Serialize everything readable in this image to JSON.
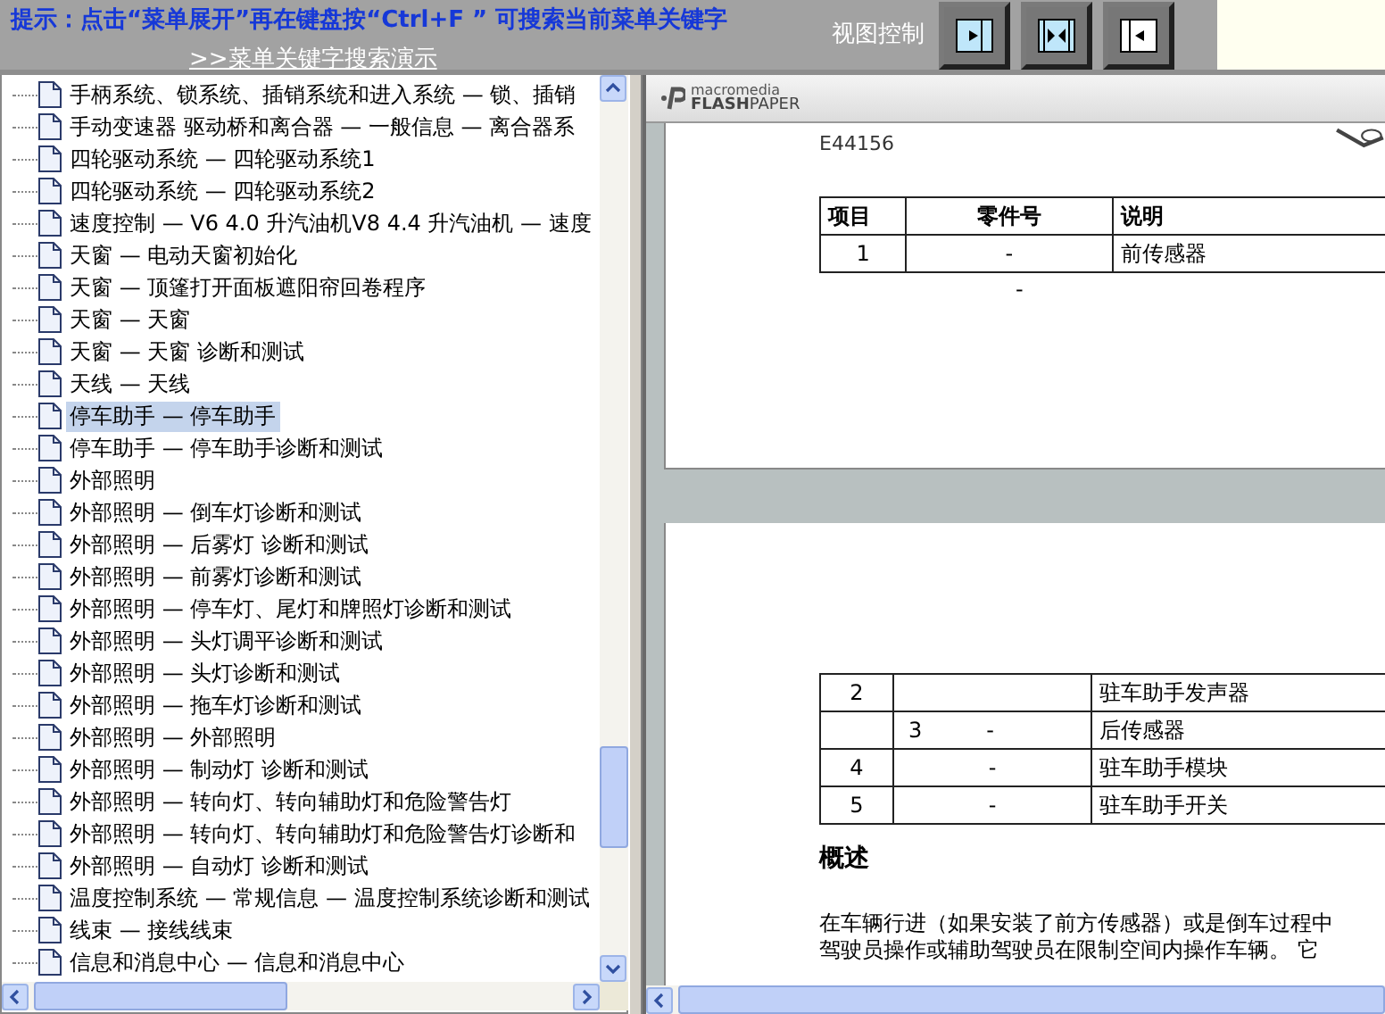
{
  "header": {
    "hint": "提示：点击“菜单展开”再在键盘按“Ctrl+F ” 可搜索当前菜单关键字",
    "demo_link": ">>菜单关键字搜索演示",
    "view_control_label": "视图控制",
    "view_buttons": [
      {
        "kind": "expand-right",
        "selected": false
      },
      {
        "kind": "split",
        "selected": false
      },
      {
        "kind": "expand-left",
        "selected": false
      }
    ]
  },
  "tree": {
    "items": [
      {
        "label": "手柄系统、锁系统、插销系统和进入系统 — 锁、插销",
        "selected": false
      },
      {
        "label": "手动变速器 驱动桥和离合器 — 一般信息 — 离合器系",
        "selected": false
      },
      {
        "label": "四轮驱动系统 — 四轮驱动系统1",
        "selected": false
      },
      {
        "label": "四轮驱动系统 — 四轮驱动系统2",
        "selected": false
      },
      {
        "label": "速度控制 — V6 4.0 升汽油机V8 4.4 升汽油机 — 速度",
        "selected": false
      },
      {
        "label": "天窗 — 电动天窗初始化",
        "selected": false
      },
      {
        "label": "天窗 — 顶篷打开面板遮阳帘回卷程序",
        "selected": false
      },
      {
        "label": "天窗 — 天窗",
        "selected": false
      },
      {
        "label": "天窗 — 天窗 诊断和测试",
        "selected": false
      },
      {
        "label": "天线 — 天线",
        "selected": false
      },
      {
        "label": "停车助手 — 停车助手",
        "selected": true
      },
      {
        "label": "停车助手 — 停车助手诊断和测试",
        "selected": false
      },
      {
        "label": "外部照明",
        "selected": false
      },
      {
        "label": "外部照明 — 倒车灯诊断和测试",
        "selected": false
      },
      {
        "label": "外部照明 — 后雾灯 诊断和测试",
        "selected": false
      },
      {
        "label": "外部照明 — 前雾灯诊断和测试",
        "selected": false
      },
      {
        "label": "外部照明 — 停车灯、尾灯和牌照灯诊断和测试",
        "selected": false
      },
      {
        "label": "外部照明 — 头灯调平诊断和测试",
        "selected": false
      },
      {
        "label": "外部照明 — 头灯诊断和测试",
        "selected": false
      },
      {
        "label": "外部照明 — 拖车灯诊断和测试",
        "selected": false
      },
      {
        "label": "外部照明 — 外部照明",
        "selected": false
      },
      {
        "label": "外部照明 — 制动灯 诊断和测试",
        "selected": false
      },
      {
        "label": "外部照明 — 转向灯、转向辅助灯和危险警告灯",
        "selected": false
      },
      {
        "label": "外部照明 — 转向灯、转向辅助灯和危险警告灯诊断和",
        "selected": false
      },
      {
        "label": "外部照明 — 自动灯 诊断和测试",
        "selected": false
      },
      {
        "label": "温度控制系统 — 常规信息 — 温度控制系统诊断和测试",
        "selected": false
      },
      {
        "label": "线束 — 接线线束",
        "selected": false
      },
      {
        "label": "信息和消息中心 — 信息和消息中心",
        "selected": false
      }
    ]
  },
  "viewer": {
    "brand_small": "macromedia",
    "brand_large": "FLASH",
    "brand_large_2": "PAPER",
    "page_1": {
      "figure_label": "E44156",
      "columns": [
        "项目",
        "零件号",
        "说明"
      ],
      "rows": [
        {
          "item": "1",
          "part": "-",
          "description": "前传感器"
        }
      ],
      "stray_text": "-"
    },
    "page_2": {
      "rows": [
        {
          "item": "2",
          "part": "",
          "description": "驻车助手发声器"
        },
        {
          "item": "",
          "part": "3",
          "part_2": "-",
          "description": "后传感器"
        },
        {
          "item": "4",
          "part": "-",
          "description": "驻车助手模块"
        },
        {
          "item": "5",
          "part": "-",
          "description": "驻车助手开关"
        }
      ],
      "heading": "概述",
      "paragraph_lines": [
        "在车辆行进（如果安装了前方传感器）或是倒车过程中",
        "驾驶员操作或辅助驾驶员在限制空间内操作车辆。 它"
      ]
    }
  }
}
